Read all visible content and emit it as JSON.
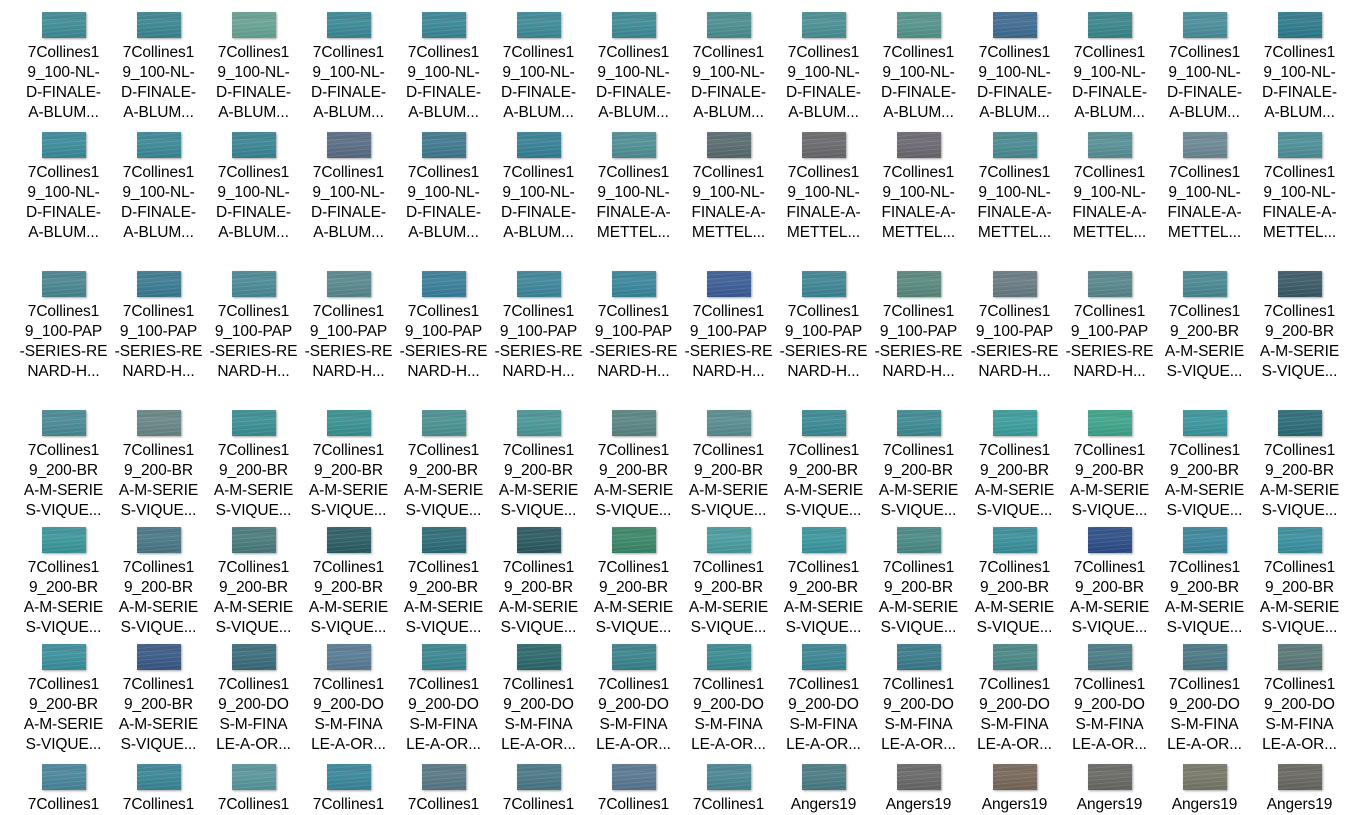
{
  "explorer": {
    "rows": [
      {
        "files": [
          {
            "name": "7Collines1\n9_100-NL-\nD-FINALE-\nA-BLUM...",
            "color": "#3f8f9a"
          },
          {
            "name": "7Collines1\n9_100-NL-\nD-FINALE-\nA-BLUM...",
            "color": "#3a8a96"
          },
          {
            "name": "7Collines1\n9_100-NL-\nD-FINALE-\nA-BLUM...",
            "color": "#6aa898"
          },
          {
            "name": "7Collines1\n9_100-NL-\nD-FINALE-\nA-BLUM...",
            "color": "#3b8c9a"
          },
          {
            "name": "7Collines1\n9_100-NL-\nD-FINALE-\nA-BLUM...",
            "color": "#3a8b9c"
          },
          {
            "name": "7Collines1\n9_100-NL-\nD-FINALE-\nA-BLUM...",
            "color": "#3d8e9c"
          },
          {
            "name": "7Collines1\n9_100-NL-\nD-FINALE-\nA-BLUM...",
            "color": "#3e8e9a"
          },
          {
            "name": "7Collines1\n9_100-NL-\nD-FINALE-\nA-BLUM...",
            "color": "#4b9296"
          },
          {
            "name": "7Collines1\n9_100-NL-\nD-FINALE-\nA-BLUM...",
            "color": "#4a9498"
          },
          {
            "name": "7Collines1\n9_100-NL-\nD-FINALE-\nA-BLUM...",
            "color": "#55988f"
          },
          {
            "name": "7Collines1\n9_100-NL-\nD-FINALE-\nA-BLUM...",
            "color": "#3f6e96"
          },
          {
            "name": "7Collines1\n9_100-NL-\nD-FINALE-\nA-BLUM...",
            "color": "#3a8a8e"
          },
          {
            "name": "7Collines1\n9_100-NL-\nD-FINALE-\nA-BLUM...",
            "color": "#4a92a0"
          },
          {
            "name": "7Collines1\n9_100-NL-\nD-FINALE-\nA-BLUM...",
            "color": "#2d7e90"
          }
        ]
      },
      {
        "files": [
          {
            "name": "7Collines1\n9_100-NL-\nD-FINALE-\nA-BLUM...",
            "color": "#3b8fa0"
          },
          {
            "name": "7Collines1\n9_100-NL-\nD-FINALE-\nA-BLUM...",
            "color": "#3c8c9c"
          },
          {
            "name": "7Collines1\n9_100-NL-\nD-FINALE-\nA-BLUM...",
            "color": "#3a8898"
          },
          {
            "name": "7Collines1\n9_100-NL-\nD-FINALE-\nA-BLUM...",
            "color": "#5a6f86"
          },
          {
            "name": "7Collines1\n9_100-NL-\nD-FINALE-\nA-BLUM...",
            "color": "#3f7c94"
          },
          {
            "name": "7Collines1\n9_100-NL-\nD-FINALE-\nA-BLUM...",
            "color": "#36849a"
          },
          {
            "name": "7Collines1\n9_100-NL-\nFINALE-A-\nMETTEL...",
            "color": "#50949a"
          },
          {
            "name": "7Collines1\n9_100-NL-\nFINALE-A-\nMETTEL...",
            "color": "#5a6e72"
          },
          {
            "name": "7Collines1\n9_100-NL-\nFINALE-A-\nMETTEL...",
            "color": "#6a6a70"
          },
          {
            "name": "7Collines1\n9_100-NL-\nFINALE-A-\nMETTEL...",
            "color": "#6e6a74"
          },
          {
            "name": "7Collines1\n9_100-NL-\nFINALE-A-\nMETTEL...",
            "color": "#4a8e96"
          },
          {
            "name": "7Collines1\n9_100-NL-\nFINALE-A-\nMETTEL...",
            "color": "#58949a"
          },
          {
            "name": "7Collines1\n9_100-NL-\nFINALE-A-\nMETTEL...",
            "color": "#6e8c98"
          },
          {
            "name": "7Collines1\n9_100-NL-\nFINALE-A-\nMETTEL...",
            "color": "#4e949c"
          }
        ]
      },
      {
        "files": [
          {
            "name": "7Collines1\n9_100-PAP\n-SERIES-RE\nNARD-H...",
            "color": "#4a8a94"
          },
          {
            "name": "7Collines1\n9_100-PAP\n-SERIES-RE\nNARD-H...",
            "color": "#3a7e96"
          },
          {
            "name": "7Collines1\n9_100-PAP\n-SERIES-RE\nNARD-H...",
            "color": "#4a8e9a"
          },
          {
            "name": "7Collines1\n9_100-PAP\n-SERIES-RE\nNARD-H...",
            "color": "#5a8c92"
          },
          {
            "name": "7Collines1\n9_100-PAP\n-SERIES-RE\nNARD-H...",
            "color": "#3a82a0"
          },
          {
            "name": "7Collines1\n9_100-PAP\n-SERIES-RE\nNARD-H...",
            "color": "#3e8aa0"
          },
          {
            "name": "7Collines1\n9_100-PAP\n-SERIES-RE\nNARD-H...",
            "color": "#3a8aa0"
          },
          {
            "name": "7Collines1\n9_100-PAP\n-SERIES-RE\nNARD-H...",
            "color": "#3c5e9a"
          },
          {
            "name": "7Collines1\n9_100-PAP\n-SERIES-RE\nNARD-H...",
            "color": "#3e8a98"
          },
          {
            "name": "7Collines1\n9_100-PAP\n-SERIES-RE\nNARD-H...",
            "color": "#5a8c82"
          },
          {
            "name": "7Collines1\n9_100-PAP\n-SERIES-RE\nNARD-H...",
            "color": "#6a7e86"
          },
          {
            "name": "7Collines1\n9_100-PAP\n-SERIES-RE\nNARD-H...",
            "color": "#5a8a90"
          },
          {
            "name": "7Collines1\n9_200-BR\nA-M-SERIE\nS-VIQUE...",
            "color": "#4a8c96"
          },
          {
            "name": "7Collines1\n9_200-BR\nA-M-SERIE\nS-VIQUE...",
            "color": "#3a5a6a"
          }
        ]
      },
      {
        "files": [
          {
            "name": "7Collines1\n9_200-BR\nA-M-SERIE\nS-VIQUE...",
            "color": "#4a8e9a"
          },
          {
            "name": "7Collines1\n9_200-BR\nA-M-SERIE\nS-VIQUE...",
            "color": "#6a8a8a"
          },
          {
            "name": "7Collines1\n9_200-BR\nA-M-SERIE\nS-VIQUE...",
            "color": "#3a9498"
          },
          {
            "name": "7Collines1\n9_200-BR\nA-M-SERIE\nS-VIQUE...",
            "color": "#3a9696"
          },
          {
            "name": "7Collines1\n9_200-BR\nA-M-SERIE\nS-VIQUE...",
            "color": "#4a9698"
          },
          {
            "name": "7Collines1\n9_200-BR\nA-M-SERIE\nS-VIQUE...",
            "color": "#4a9a9c"
          },
          {
            "name": "7Collines1\n9_200-BR\nA-M-SERIE\nS-VIQUE...",
            "color": "#5a8a86"
          },
          {
            "name": "7Collines1\n9_200-BR\nA-M-SERIE\nS-VIQUE...",
            "color": "#5a9094"
          },
          {
            "name": "7Collines1\n9_200-BR\nA-M-SERIE\nS-VIQUE...",
            "color": "#3a8e98"
          },
          {
            "name": "7Collines1\n9_200-BR\nA-M-SERIE\nS-VIQUE...",
            "color": "#3e8e96"
          },
          {
            "name": "7Collines1\n9_200-BR\nA-M-SERIE\nS-VIQUE...",
            "color": "#3aa2a0"
          },
          {
            "name": "7Collines1\n9_200-BR\nA-M-SERIE\nS-VIQUE...",
            "color": "#3eaa8e"
          },
          {
            "name": "7Collines1\n9_200-BR\nA-M-SERIE\nS-VIQUE...",
            "color": "#3a9aa2"
          },
          {
            "name": "7Collines1\n9_200-BR\nA-M-SERIE\nS-VIQUE...",
            "color": "#2a6e7a"
          }
        ]
      },
      {
        "files": [
          {
            "name": "7Collines1\n9_200-BR\nA-M-SERIE\nS-VIQUE...",
            "color": "#3a9aa0"
          },
          {
            "name": "7Collines1\n9_200-BR\nA-M-SERIE\nS-VIQUE...",
            "color": "#4a7a8a"
          },
          {
            "name": "7Collines1\n9_200-BR\nA-M-SERIE\nS-VIQUE...",
            "color": "#4a7e80"
          },
          {
            "name": "7Collines1\n9_200-BR\nA-M-SERIE\nS-VIQUE...",
            "color": "#2a5e66"
          },
          {
            "name": "7Collines1\n9_200-BR\nA-M-SERIE\nS-VIQUE...",
            "color": "#2a6e7a"
          },
          {
            "name": "7Collines1\n9_200-BR\nA-M-SERIE\nS-VIQUE...",
            "color": "#2a5a62"
          },
          {
            "name": "7Collines1\n9_200-BR\nA-M-SERIE\nS-VIQUE...",
            "color": "#3a8a6a"
          },
          {
            "name": "7Collines1\n9_200-BR\nA-M-SERIE\nS-VIQUE...",
            "color": "#4aa0a4"
          },
          {
            "name": "7Collines1\n9_200-BR\nA-M-SERIE\nS-VIQUE...",
            "color": "#3a9aa2"
          },
          {
            "name": "7Collines1\n9_200-BR\nA-M-SERIE\nS-VIQUE...",
            "color": "#4a8e88"
          },
          {
            "name": "7Collines1\n9_200-BR\nA-M-SERIE\nS-VIQUE...",
            "color": "#3a94a0"
          },
          {
            "name": "7Collines1\n9_200-BR\nA-M-SERIE\nS-VIQUE...",
            "color": "#2a4e8a"
          },
          {
            "name": "7Collines1\n9_200-BR\nA-M-SERIE\nS-VIQUE...",
            "color": "#3a8aa0"
          },
          {
            "name": "7Collines1\n9_200-BR\nA-M-SERIE\nS-VIQUE...",
            "color": "#3a94a4"
          }
        ]
      },
      {
        "files": [
          {
            "name": "7Collines1\n9_200-BR\nA-M-SERIE\nS-VIQUE...",
            "color": "#3a94a2"
          },
          {
            "name": "7Collines1\n9_200-BR\nA-M-SERIE\nS-VIQUE...",
            "color": "#3a5a8a"
          },
          {
            "name": "7Collines1\n9_200-DO\nS-M-FINA\nLE-A-OR...",
            "color": "#3a6e7e"
          },
          {
            "name": "7Collines1\n9_200-DO\nS-M-FINA\nLE-A-OR...",
            "color": "#5a7e98"
          },
          {
            "name": "7Collines1\n9_200-DO\nS-M-FINA\nLE-A-OR...",
            "color": "#3a8a94"
          },
          {
            "name": "7Collines1\n9_200-DO\nS-M-FINA\nLE-A-OR...",
            "color": "#2a6a6e"
          },
          {
            "name": "7Collines1\n9_200-DO\nS-M-FINA\nLE-A-OR...",
            "color": "#3a8690"
          },
          {
            "name": "7Collines1\n9_200-DO\nS-M-FINA\nLE-A-OR...",
            "color": "#3a8e96"
          },
          {
            "name": "7Collines1\n9_200-DO\nS-M-FINA\nLE-A-OR...",
            "color": "#3a8a98"
          },
          {
            "name": "7Collines1\n9_200-DO\nS-M-FINA\nLE-A-OR...",
            "color": "#3a7e8e"
          },
          {
            "name": "7Collines1\n9_200-DO\nS-M-FINA\nLE-A-OR...",
            "color": "#4a8a8a"
          },
          {
            "name": "7Collines1\n9_200-DO\nS-M-FINA\nLE-A-OR...",
            "color": "#4a7e8a"
          },
          {
            "name": "7Collines1\n9_200-DO\nS-M-FINA\nLE-A-OR...",
            "color": "#4a7a88"
          },
          {
            "name": "7Collines1\n9_200-DO\nS-M-FINA\nLE-A-OR...",
            "color": "#5a7a7a"
          }
        ]
      },
      {
        "files": [
          {
            "name": "7Collines1",
            "color": "#4a8aa0"
          },
          {
            "name": "7Collines1",
            "color": "#3a8a9c"
          },
          {
            "name": "7Collines1",
            "color": "#5a9aa2"
          },
          {
            "name": "7Collines1",
            "color": "#3a8aa0"
          },
          {
            "name": "7Collines1",
            "color": "#5a7a8a"
          },
          {
            "name": "7Collines1",
            "color": "#4a7a8a"
          },
          {
            "name": "7Collines1",
            "color": "#5a7a96"
          },
          {
            "name": "7Collines1",
            "color": "#4a8a96"
          },
          {
            "name": "Angers19",
            "color": "#4a7e88"
          },
          {
            "name": "Angers19",
            "color": "#6a6a6a"
          },
          {
            "name": "Angers19",
            "color": "#7a6a5a"
          },
          {
            "name": "Angers19",
            "color": "#6a6a66"
          },
          {
            "name": "Angers19",
            "color": "#7a7a6a"
          },
          {
            "name": "Angers19",
            "color": "#6a6a62"
          }
        ]
      }
    ]
  }
}
